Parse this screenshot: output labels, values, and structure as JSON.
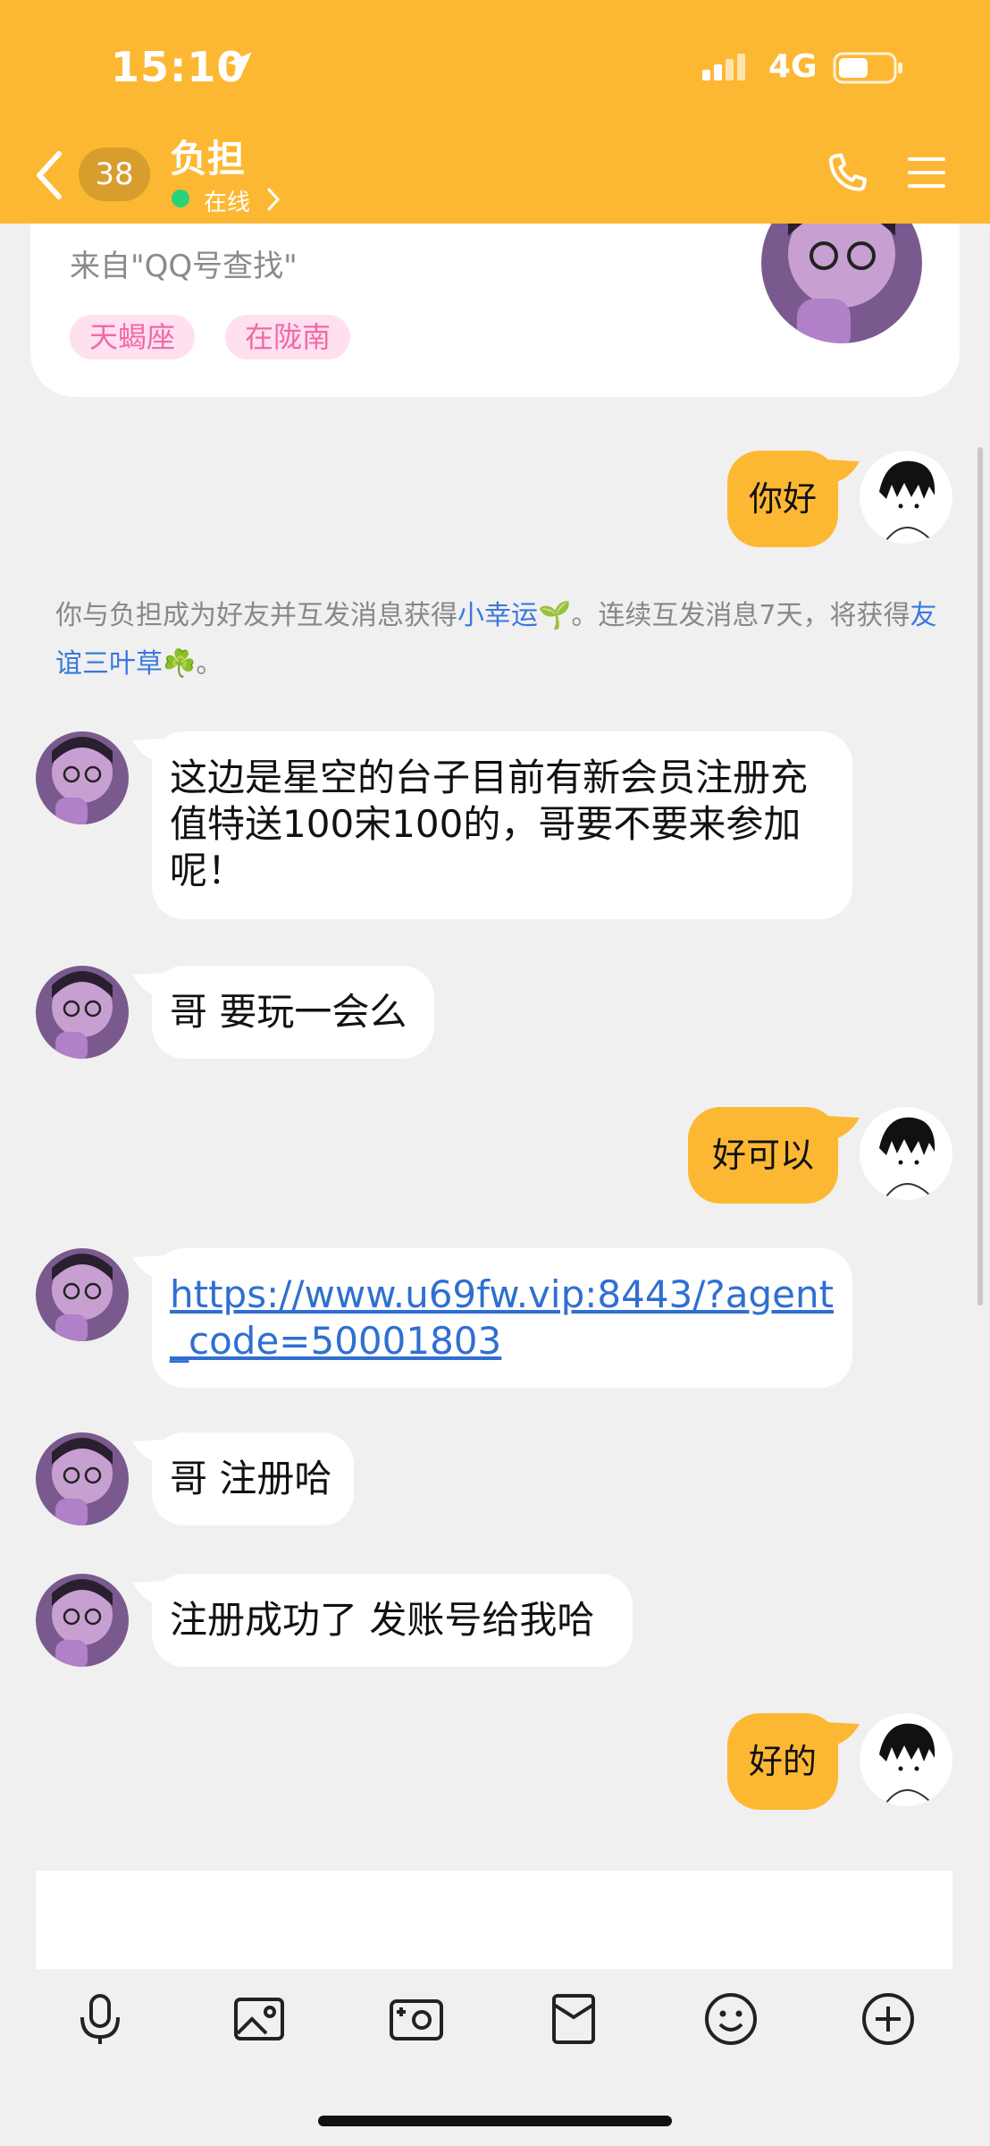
{
  "status_bar": {
    "time": "15:10",
    "network": "4G"
  },
  "header": {
    "unread_count": "38",
    "contact_name": "负担",
    "presence": "在线"
  },
  "profile_card": {
    "source": "来自\"QQ号查找\"",
    "tags": [
      "天蝎座",
      "在陇南"
    ]
  },
  "messages": [
    {
      "side": "out",
      "text": "你好"
    },
    {
      "side": "in",
      "text": "这边是星空的台子目前有新会员注册充值特送100宋100的，哥要不要来参加呢！"
    },
    {
      "side": "in",
      "text": "哥 要玩一会么"
    },
    {
      "side": "out",
      "text": "好可以"
    },
    {
      "side": "in",
      "text": "https://www.u69fw.vip:8443/?agent_code=50001803"
    },
    {
      "side": "in",
      "text": "哥 注册哈"
    },
    {
      "side": "in",
      "text": "注册成功了 发账号给我哈"
    },
    {
      "side": "out",
      "text": "好的"
    }
  ],
  "system_notice": {
    "part1": "你与负担成为好友并互发消息获得",
    "link1": "小幸运",
    "part2": "🌱。连续互发消息7天，将获得",
    "link2": "友谊三叶草",
    "part3": "☘️。"
  },
  "toolbar": [
    "microphone-icon",
    "photo-icon",
    "camera-icon",
    "red-packet-icon",
    "emoji-icon",
    "plus-icon"
  ],
  "colors": {
    "header": "#fdb833",
    "outgoing_bubble": "#fdb833",
    "incoming_bubble": "#ffffff",
    "link": "#2f6fd1",
    "tag_bg": "#ffe0ef",
    "tag_text": "#f06aa8"
  }
}
